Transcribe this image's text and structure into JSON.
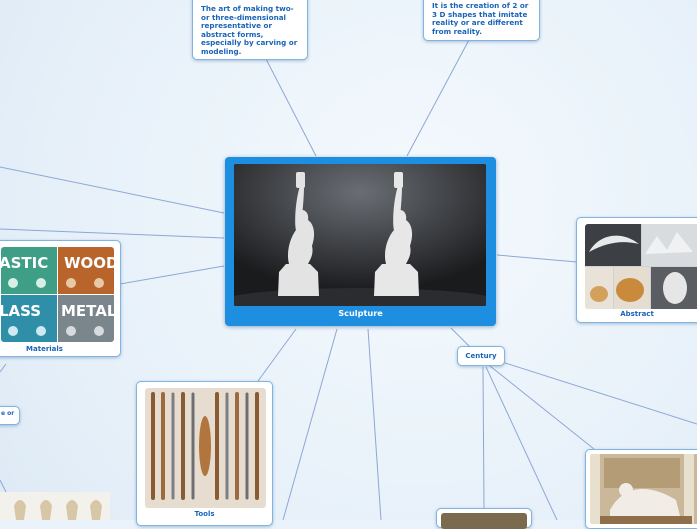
{
  "diagram": {
    "central_topic": "Sculpture",
    "definition_1": "The art of making two- or three-dimensional representative or abstract forms, especially by carving or modeling.",
    "definition_2": "It is the creation of 2 or 3 D shapes that imitate reality or are different from reality.",
    "materials_label": "Materials",
    "tools_label": "Tools",
    "abstract_label": "Abstract",
    "century_label": "Century",
    "partial_left_note": "e or",
    "material_words": [
      "ASTIC",
      "WOOD",
      "LASS",
      "METAL"
    ]
  },
  "colors": {
    "accent": "#1e8fe0",
    "text": "#1a64b8",
    "connector": "#8ea7d6",
    "node_border": "#7fb4e3"
  }
}
